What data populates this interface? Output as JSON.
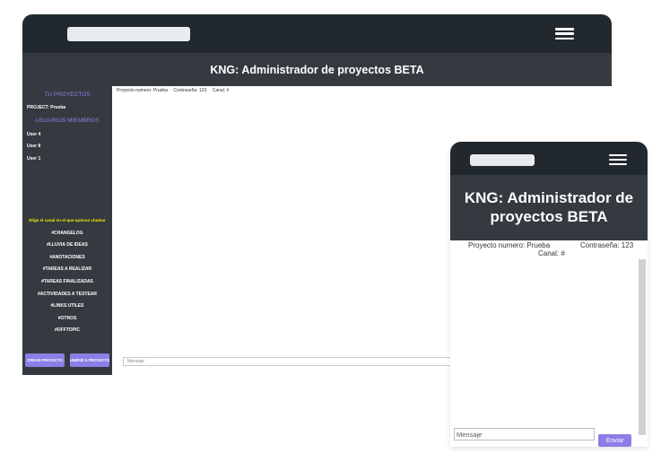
{
  "desktop": {
    "title": "KNG: Administrador de proyectos BETA",
    "sidebar": {
      "your_projects_heading": "TU PROYECTOS",
      "project_label": "PROJECT: Prueba",
      "members_heading": "USUARIOS MIEMBROS",
      "members": [
        "User 4",
        "User 8",
        "User 1"
      ],
      "channel_prompt": "Elige el canal en el que quieras chatear",
      "channels": [
        "#CHANGELOG",
        "#LLUVIA DE IDEAS",
        "#ANOTACIONES",
        "#TAREAS A REALIZAR",
        "#TAREAS FINALIZADAS",
        "#ACTIVIDADES A TESTEAR",
        "#LINKS UTILES",
        "#OTROS",
        "#OFFTOPIC"
      ],
      "create_project_button": "CREAR PROYECTO",
      "join_project_button": "UNIRSE A PROYECTO"
    },
    "info": {
      "project": "Proyecto numero: Prueba",
      "password": "Contraseña: 123",
      "channel": "Canal: #"
    },
    "message_placeholder": "Mensaje"
  },
  "mobile": {
    "title": "KNG: Administrador de proyectos BETA",
    "info": {
      "project": "Proyecto numero: Prueba",
      "password": "Contraseña: 123",
      "channel": "Canal: #"
    },
    "message_placeholder": "Mensaje",
    "send_button": "Enviar"
  },
  "colors": {
    "topbar": "#21292e",
    "titlebar": "#343a40",
    "accent": "#8c7ee6",
    "prompt": "#f2e600"
  },
  "icons": {
    "menu": "hamburger-menu-icon",
    "logo": "logo-placeholder"
  }
}
